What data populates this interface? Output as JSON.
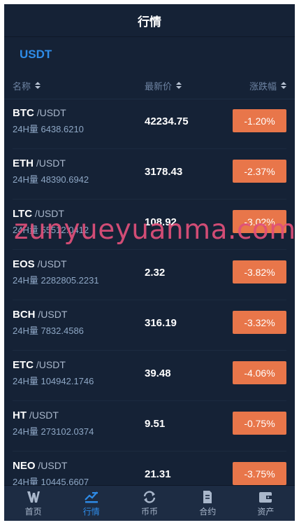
{
  "header": {
    "title": "行情"
  },
  "tabs": {
    "active": "USDT"
  },
  "columns": {
    "name": "名称",
    "price": "最新价",
    "change": "涨跌幅"
  },
  "rows": [
    {
      "symbol": "BTC",
      "quote": " /USDT",
      "volume": "24H量 6438.6210",
      "price": "42234.75",
      "change": "-1.20%"
    },
    {
      "symbol": "ETH",
      "quote": " /USDT",
      "volume": "24H量 48390.6942",
      "price": "3178.43",
      "change": "-2.37%"
    },
    {
      "symbol": "LTC",
      "quote": " /USDT",
      "volume": "24H量 55512.0412",
      "price": "108.92",
      "change": "-3.02%"
    },
    {
      "symbol": "EOS",
      "quote": " /USDT",
      "volume": "24H量 2282805.2231",
      "price": "2.32",
      "change": "-3.82%"
    },
    {
      "symbol": "BCH",
      "quote": " /USDT",
      "volume": "24H量 7832.4586",
      "price": "316.19",
      "change": "-3.32%"
    },
    {
      "symbol": "ETC",
      "quote": " /USDT",
      "volume": "24H量 104942.1746",
      "price": "39.48",
      "change": "-4.06%"
    },
    {
      "symbol": "HT",
      "quote": " /USDT",
      "volume": "24H量 273102.0374",
      "price": "9.51",
      "change": "-0.75%"
    },
    {
      "symbol": "NEO",
      "quote": " /USDT",
      "volume": "24H量 10445.6607",
      "price": "21.31",
      "change": "-3.75%"
    }
  ],
  "watermark": "zunyueyuanma.com",
  "nav": {
    "home": "首页",
    "market": "行情",
    "exchange": "币币",
    "contract": "合约",
    "assets": "资产"
  },
  "colors": {
    "background": "#152236",
    "accent": "#2e8ce8",
    "down": "#e8764a",
    "watermark": "#e0507a"
  }
}
